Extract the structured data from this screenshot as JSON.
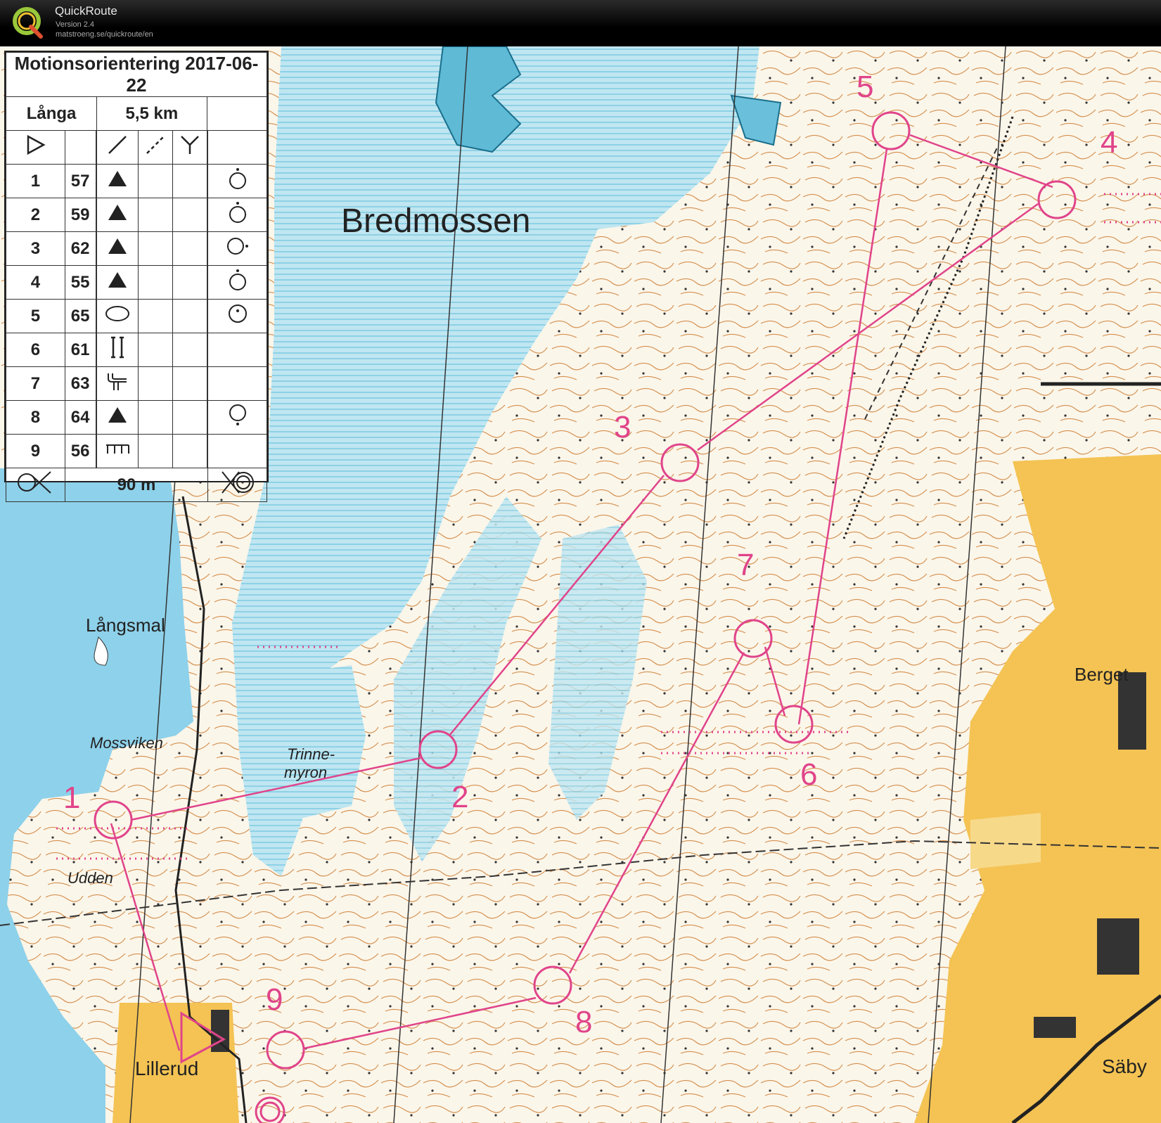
{
  "app": {
    "title": "QuickRoute",
    "version": "Version 2.4",
    "url": "matstroeng.se/quickroute/en"
  },
  "colors": {
    "course": "#e0448a",
    "water": "#9fd9ea",
    "open_land": "#f3c24f",
    "forest": "#fbf8ee",
    "contour": "#c8813a"
  },
  "description_sheet": {
    "event": "Motionsorientering 2017-06-22",
    "course": "Långa",
    "length": "5,5 km",
    "controls": [
      {
        "num": "1",
        "code": "57",
        "feature": "boulder-icon",
        "location": "foot-icon"
      },
      {
        "num": "2",
        "code": "59",
        "feature": "boulder-icon",
        "location": "foot-icon"
      },
      {
        "num": "3",
        "code": "62",
        "feature": "boulder-icon",
        "location": "east-side-icon"
      },
      {
        "num": "4",
        "code": "55",
        "feature": "boulder-icon",
        "location": "foot-icon"
      },
      {
        "num": "5",
        "code": "65",
        "feature": "marsh-icon",
        "location": "circle-dot-icon"
      },
      {
        "num": "6",
        "code": "61",
        "feature": "passage-icon",
        "location": ""
      },
      {
        "num": "7",
        "code": "63",
        "feature": "path-junction-icon",
        "location": ""
      },
      {
        "num": "8",
        "code": "64",
        "feature": "boulder-icon",
        "location": "south-foot-icon"
      },
      {
        "num": "9",
        "code": "56",
        "feature": "fence-icon",
        "location": ""
      }
    ],
    "finish_distance": "90 m"
  },
  "map": {
    "place_names": [
      {
        "id": "bredmossen",
        "text": "Bredmossen"
      },
      {
        "id": "langsmal",
        "text": "Långsmal"
      },
      {
        "id": "mossviken",
        "text": "Mossviken"
      },
      {
        "id": "trinne",
        "text": "Trinne-"
      },
      {
        "id": "myron",
        "text": "myron"
      },
      {
        "id": "udden",
        "text": "Udden"
      },
      {
        "id": "lillerud",
        "text": "Lillerud"
      },
      {
        "id": "berget",
        "text": "Berget"
      },
      {
        "id": "saby",
        "text": "Säby"
      }
    ],
    "controls": [
      "1",
      "2",
      "3",
      "4",
      "5",
      "6",
      "7",
      "8",
      "9"
    ]
  }
}
